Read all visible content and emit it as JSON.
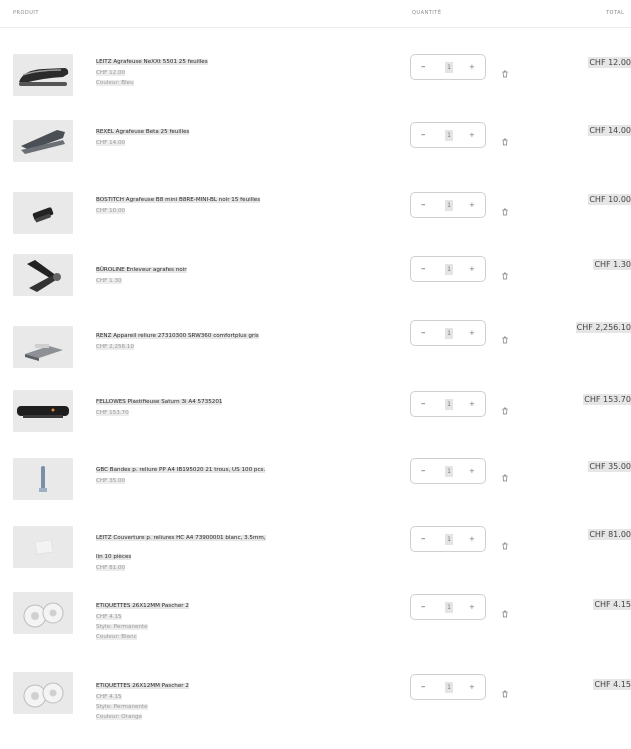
{
  "header": {
    "product": "PRODUIT",
    "quantity": "QUANTITÉ",
    "total": "TOTAL"
  },
  "items": [
    {
      "name": "LEITZ Agrafeuse NeXXt 5501 25 feuilles",
      "price": "CHF 12.00",
      "details": [
        "Couleur: Bleu"
      ],
      "qty": "1",
      "total": "CHF 12.00",
      "thumb": "stapler-black-icon"
    },
    {
      "name": "REXEL Agrafeuse Beta 25 feuilles",
      "price": "CHF 14.00",
      "details": [],
      "qty": "1",
      "total": "CHF 14.00",
      "thumb": "stapler-grey-icon"
    },
    {
      "name": "BOSTITCH Agrafeuse B8 mini B8RE-MINI-BL noir 15 feuilles",
      "price": "CHF 10.00",
      "details": [],
      "qty": "1",
      "total": "CHF 10.00",
      "thumb": "mini-stapler-icon"
    },
    {
      "name": "BÜROLINE Enleveur agrafes noir",
      "price": "CHF 1.30",
      "details": [],
      "qty": "1",
      "total": "CHF 1.30",
      "thumb": "staple-remover-icon"
    },
    {
      "name": "RENZ Appareil reliure 27310300 SRW360 comfortplus gris",
      "price": "CHF 2,256.10",
      "details": [],
      "qty": "1",
      "total": "CHF 2,256.10",
      "thumb": "binding-machine-icon"
    },
    {
      "name": "FELLOWES Plastifieuse Saturn 3i A4 5735201",
      "price": "CHF 153.70",
      "details": [],
      "qty": "1",
      "total": "CHF 153.70",
      "thumb": "laminator-icon"
    },
    {
      "name": "GBC Bandes p. reliure PP A4 IB195020 21 trous, US 100 pcs.",
      "price": "CHF 35.00",
      "details": [],
      "qty": "1",
      "total": "CHF 35.00",
      "thumb": "binding-strip-icon"
    },
    {
      "name": "LEITZ Couverture p. reliures HC A4 73900001 blanc, 3.5mm, lin 10 pièces",
      "price": "CHF 81.00",
      "details": [],
      "qty": "1",
      "total": "CHF 81.00",
      "thumb": "binding-cover-icon"
    },
    {
      "name": "ETIQUETTES 26X12MM Pascher 2",
      "price": "CHF 4.15",
      "details": [
        "Style: Permanente",
        "Couleur: Blanc"
      ],
      "qty": "1",
      "total": "CHF 4.15",
      "thumb": "label-rolls-icon"
    },
    {
      "name": "ETIQUETTES 26X12MM Pascher 2",
      "price": "CHF 4.15",
      "details": [
        "Style: Permanente",
        "Couleur: Orange"
      ],
      "qty": "1",
      "total": "CHF 4.15",
      "thumb": "label-rolls-icon"
    }
  ],
  "controls": {
    "minus_glyph": "–",
    "plus_glyph": "+"
  }
}
